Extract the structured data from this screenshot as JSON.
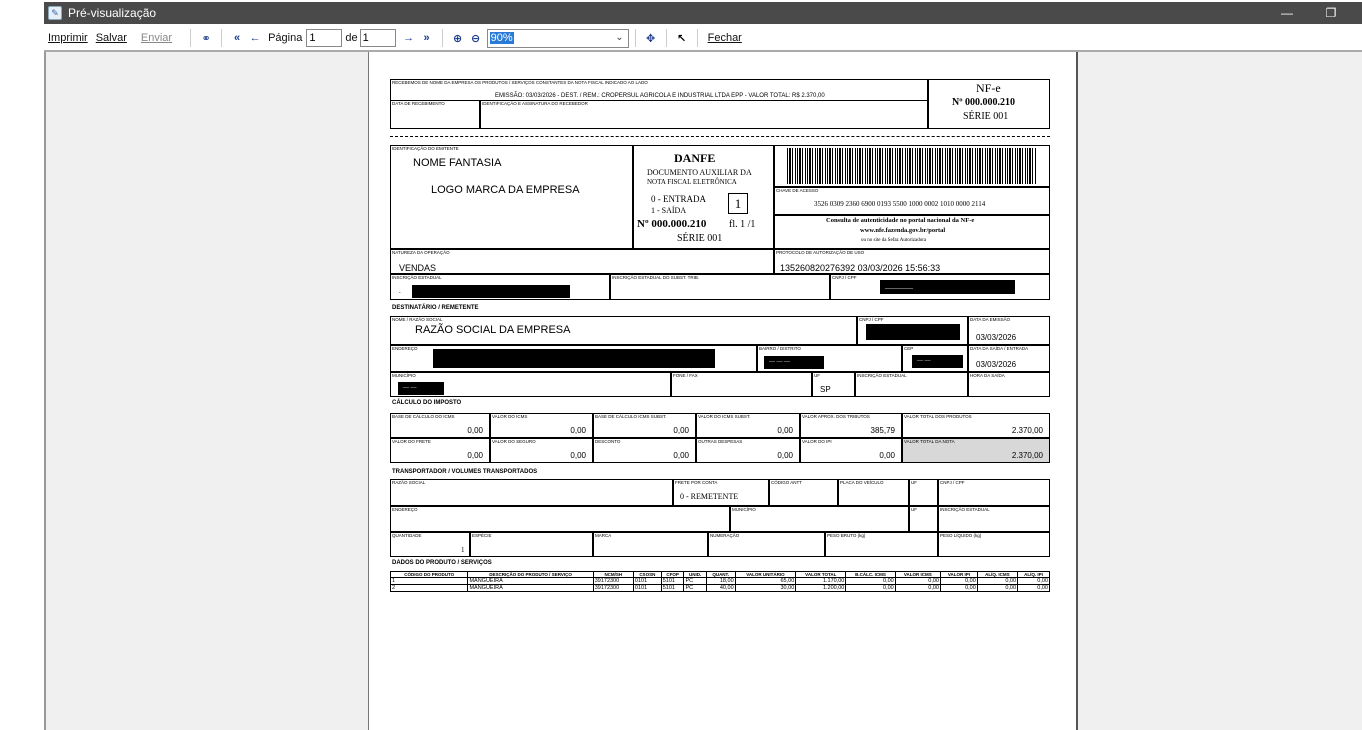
{
  "window": {
    "title": "Pré-visualização",
    "minimize": "—",
    "restore": "❐"
  },
  "toolbar": {
    "print": "Imprimir",
    "save": "Salvar",
    "send": "Enviar",
    "page_label": "Página",
    "page_value": "1",
    "of_label": "de",
    "of_value": "1",
    "zoom": "90%",
    "close": "Fechar"
  },
  "icons": {
    "find": "binoculars-icon",
    "first": "first-page-icon",
    "prev": "prev-page-icon",
    "next": "next-page-icon",
    "last": "last-page-icon",
    "zoom_in": "zoom-in-icon",
    "zoom_out": "zoom-out-icon",
    "fit": "fit-page-icon",
    "pointer": "pointer-icon"
  },
  "doc": {
    "receipt_header": "RECEBEMOS DE NOME DA EMPRESA OS PRODUTOS / SERVIÇOS CONSTANTES DA NOTA FISCAL INDICADO AO LADO",
    "receipt_line": "EMISSÃO: 03/03/2026 - DEST. / REM.: CROPERSUL AGRICOLA E INDUSTRIAL LTDA EPP - VALOR TOTAL: R$ 2.370,00",
    "receipt_date_label": "DATA DE RECEBIMENTO",
    "receipt_sig_label": "IDENTIFICAÇÃO E ASSINATURA DO RECEBEDOR",
    "nfe_title": "NF-e",
    "nfe_number": "Nº 000.000.210",
    "nfe_series": "SÉRIE 001",
    "emitter_label": "IDENTIFICAÇÃO DO EMITENTE",
    "fantasy_name": "NOME FANTASIA",
    "logo_text": "LOGO MARCA DA EMPRESA",
    "danfe": "DANFE",
    "danfe_sub1": "DOCUMENTO AUXILIAR DA",
    "danfe_sub2": "NOTA FISCAL ELETRÔNICA",
    "entrada": "0 - ENTRADA",
    "saida": "1 - SAÍDA",
    "tipo": "1",
    "danfe_number": "Nº 000.000.210",
    "folha": "fl. 1 /1",
    "danfe_series": "SÉRIE 001",
    "access_key_label": "CHAVE DE ACESSO",
    "access_key": "3526 0309 2360 6900 0193 5500 1000 0002 1010 0000 2114",
    "consulta1": "Consulta de autenticidade no portal nacional da NF-e",
    "consulta2": "www.nfe.fazenda.gov.br/portal",
    "consulta3": "ou no site da Sefaz Autorizadora",
    "natureza_label": "NATUREZA DA OPERAÇÃO",
    "natureza": "VENDAS",
    "protocolo_label": "PROTOCOLO DE AUTORIZAÇÃO DE USO",
    "protocolo": "135260820276392 03/03/2026 15:56:33",
    "ie_label": "INSCRIÇÃO ESTADUAL",
    "ie_value": ".",
    "ie_st_label": "INSCRIÇÃO ESTADUAL DO SUBST. TRIB.",
    "cnpj_label": "CNPJ / CPF",
    "cnpj_value": "________",
    "dest_section": "DESTINATÁRIO / REMETENTE",
    "razao_label": "NOME / RAZÃO SOCIAL",
    "razao": "RAZÃO SOCIAL DA EMPRESA",
    "dest_cnpj_label": "CNPJ / CPF",
    "emissao_label": "DATA DA EMISSÃO",
    "emissao": "03/03/2026",
    "endereco_label": "ENDEREÇO",
    "bairro_label": "BAIRRO / DISTRITO",
    "bairro_value": "— — —",
    "cep_label": "CEP",
    "cep_value": "— —",
    "saida_label": "DATA DA SAÍDA / ENTRADA",
    "saida_date": "03/03/2026",
    "municipio_label": "MUNICÍPIO",
    "municipio_value": "— —",
    "fone_label": "FONE / FAX",
    "uf_label": "UF",
    "uf": "SP",
    "ie_dest_label": "INSCRIÇÃO ESTADUAL",
    "hora_label": "HORA DA SAÍDA",
    "imposto_section": "CÁLCULO DO IMPOSTO",
    "imposto_row1": [
      {
        "label": "BASE DE CÁLCULO DO ICMS",
        "value": "0,00"
      },
      {
        "label": "VALOR DO ICMS",
        "value": "0,00"
      },
      {
        "label": "BASE DE CÁLCULO ICMS SUBST.",
        "value": "0,00"
      },
      {
        "label": "VALOR DO ICMS SUBST.",
        "value": "0,00"
      },
      {
        "label": "VALOR APROX. DOS TRIBUTOS",
        "value": "385,79"
      },
      {
        "label": "VALOR TOTAL DOS PRODUTOS",
        "value": "2.370,00"
      }
    ],
    "imposto_row2": [
      {
        "label": "VALOR DO FRETE",
        "value": "0,00"
      },
      {
        "label": "VALOR DO SEGURO",
        "value": "0,00"
      },
      {
        "label": "DESCONTO",
        "value": "0,00"
      },
      {
        "label": "OUTRAS DESPESAS",
        "value": "0,00"
      },
      {
        "label": "VALOR DO IPI",
        "value": "0,00"
      },
      {
        "label": "VALOR TOTAL DA NOTA",
        "value": "2.370,00"
      }
    ],
    "transp_section": "TRANSPORTADOR / VOLUMES TRANSPORTADOS",
    "transp_razao_label": "RAZÃO SOCIAL",
    "frete_label": "FRETE POR CONTA",
    "frete": "0 - REMETENTE",
    "antt_label": "CÓDIGO ANTT",
    "placa_label": "PLACA DO VEÍCULO",
    "transp_uf_label": "UF",
    "transp_cnpj_label": "CNPJ / CPF",
    "transp_end_label": "ENDEREÇO",
    "transp_mun_label": "MUNICÍPIO",
    "transp_uf2_label": "UF",
    "transp_ie_label": "INSCRIÇÃO ESTADUAL",
    "qtd_label": "QUANTIDADE",
    "qtd": "1",
    "especie_label": "ESPÉCIE",
    "marca_label": "MARCA",
    "numeracao_label": "NUMERAÇÃO",
    "pbruto_label": "PESO BRUTO (kg)",
    "pliq_label": "PESO LÍQUIDO (kg)",
    "produtos_section": "DADOS DO PRODUTO / SERVIÇOS",
    "product_headers": [
      "CÓDIGO DO PRODUTO",
      "DESCRIÇÃO DO PRODUTO / SERVIÇO",
      "NCM/SH",
      "CSOSN",
      "CFOP",
      "UNID.",
      "QUANT.",
      "VALOR UNITÁRIO",
      "VALOR TOTAL",
      "B.CÁLC. ICMS",
      "VALOR ICMS",
      "VALOR IPI",
      "ALÍQ. ICMS",
      "ALÍQ. IPI"
    ],
    "products": [
      [
        "1",
        "MANGUEIRA",
        "39172300",
        "0101",
        "5101",
        "PC",
        "18,00",
        "65,00",
        "1.170,00",
        "0,00",
        "0,00",
        "0,00",
        "0,00",
        "0,00"
      ],
      [
        "2",
        "MANGUEIRA",
        "39172300",
        "0101",
        "5101",
        "PC",
        "40,00",
        "30,00",
        "1.200,00",
        "0,00",
        "0,00",
        "0,00",
        "0,00",
        "0,00"
      ]
    ]
  }
}
